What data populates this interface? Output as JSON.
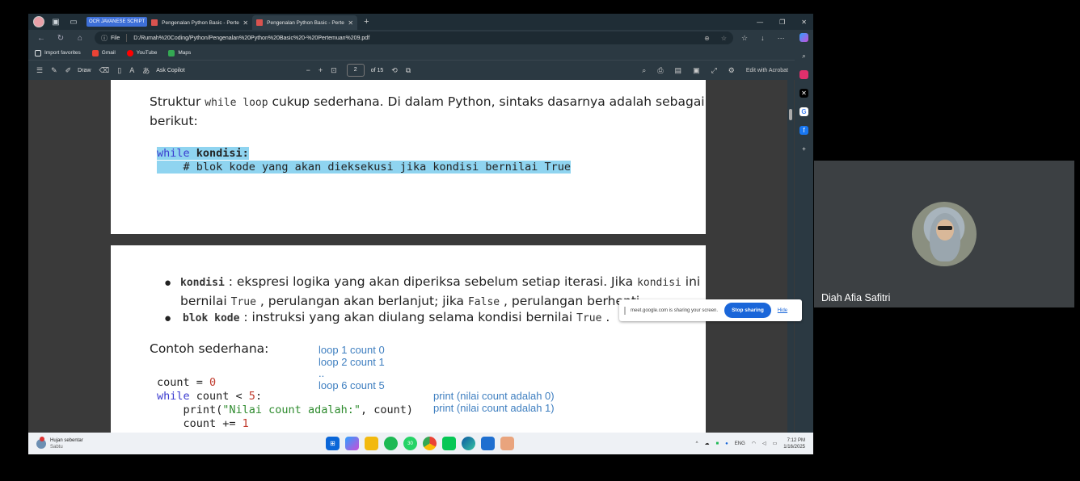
{
  "browser": {
    "tab_group": "OCR JAVANESE SCRIPT",
    "tabs": [
      {
        "label": "Pengenalan Python Basic - Pertem"
      },
      {
        "label": "Pengenalan Python Basic - Pertem"
      }
    ],
    "address": {
      "scheme_label": "File",
      "url": "D:/Rumah%20Coding/Python/Pengenalan%20Python%20Basic%20-%20Pertemuan%209.pdf"
    },
    "favorites": [
      {
        "label": "Import favorites",
        "color": "#dfe3e6"
      },
      {
        "label": "Gmail",
        "color": "#ea4335"
      },
      {
        "label": "YouTube",
        "color": "#ff0000"
      },
      {
        "label": "Maps",
        "color": "#34a853"
      }
    ]
  },
  "pdf_toolbar": {
    "draw_label": "Draw",
    "copilot_label": "Ask Copilot",
    "page_current": "2",
    "page_total": "of 15",
    "edit_label": "Edit with Acrobat"
  },
  "page1": {
    "intro_prefix": "Struktur ",
    "intro_code": "while loop",
    "intro_suffix": " cukup sederhana. Di dalam Python, sintaks dasarnya adalah sebagai",
    "intro_line2": "berikut:",
    "code_kw": "while",
    "code_rest": " kondisi:",
    "code_comment": "    # blok kode yang akan dieksekusi jika kondisi bernilai True"
  },
  "page2": {
    "b1_term": "kondisi",
    "b1_text1": " : ekspresi logika yang akan diperiksa sebelum setiap iterasi. Jika ",
    "b1_code1": "kondisi",
    "b1_text2": " ini",
    "b1_l2_a": "bernilai ",
    "b1_l2_code1": "True",
    "b1_l2_b": " , perulangan akan berlanjut; jika ",
    "b1_l2_code2": "False",
    "b1_l2_c": " , perulangan berhenti.",
    "b2_term": "blok kode",
    "b2_text": " : instruksi yang akan diulang selama kondisi bernilai ",
    "b2_code": "True",
    "b2_end": " .",
    "example_heading": "Contoh sederhana:",
    "code": {
      "l1_var": "count = ",
      "l1_num": "0",
      "l2_kw": "while",
      "l2_rest": " count < ",
      "l2_num": "5",
      "l2_end": ":",
      "l3_fn": "    print(",
      "l3_str": "\"Nilai count adalah:\"",
      "l3_end": ", count)",
      "l4_var": "    count += ",
      "l4_num": "1"
    },
    "notes_left": [
      "loop 1 count 0",
      "loop 2 count 1",
      "..",
      "loop 6 count 5"
    ],
    "notes_right": [
      "print (nilai count adalah 0)",
      "print (nilai count adalah 1)"
    ]
  },
  "taskbar": {
    "weather_title": "Hujan sebentar",
    "weather_sub": "Sabtu",
    "lang": "ENG",
    "time": "7:12 PM",
    "date": "1/16/2025",
    "badge_count": "30"
  },
  "share_toast": {
    "message": "meet.google.com is sharing your screen.",
    "stop_label": "Stop sharing",
    "hide_label": "Hide"
  },
  "participant": {
    "name": "Diah Afia Safitri"
  }
}
